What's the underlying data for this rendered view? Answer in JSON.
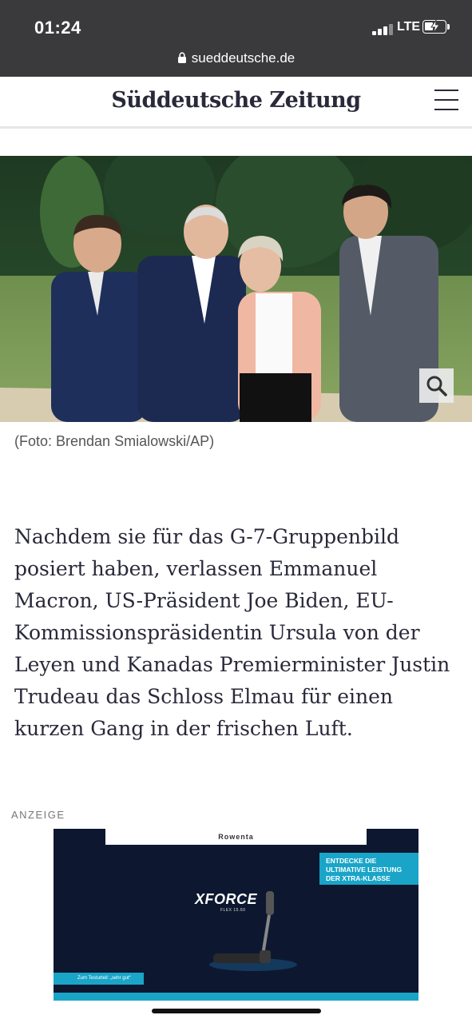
{
  "status_bar": {
    "time": "01:24",
    "network": "LTE",
    "url": "sueddeutsche.de"
  },
  "header": {
    "logo": "Süddeutsche Zeitung",
    "menu_icon": "hamburger-menu-icon"
  },
  "photo": {
    "zoom_icon": "magnifier-icon",
    "caption": "(Foto: Brendan Smialowski/AP)"
  },
  "article": {
    "paragraph": "Nachdem sie für das G-7-Gruppenbild posiert haben, verlassen Emmanuel Macron, US-Prä­sident Joe Biden, EU-Kommissionspräsiden­tin Ursula von der Leyen und Kanadas Premierminister Justin Trudeau das Schloss Elmau für einen kurzen Gang in der fri­schen Luft."
  },
  "ad": {
    "label": "ANZEIGE",
    "brand": "Rowenta",
    "callout_line1": "ENTDECKE DIE",
    "callout_line2": "ULTIMATIVE LEISTUNG",
    "callout_line3": "DER XTRA-KLASSE",
    "product": "XFORCE",
    "model": "FLEX 15.60",
    "test_badge": "Zum Testurteil: „sehr gut“"
  },
  "colors": {
    "status_bar_bg": "#3a3a3c",
    "logo_text": "#29293a",
    "ad_accent": "#1aa5c8",
    "ad_bg": "#0d1830"
  }
}
